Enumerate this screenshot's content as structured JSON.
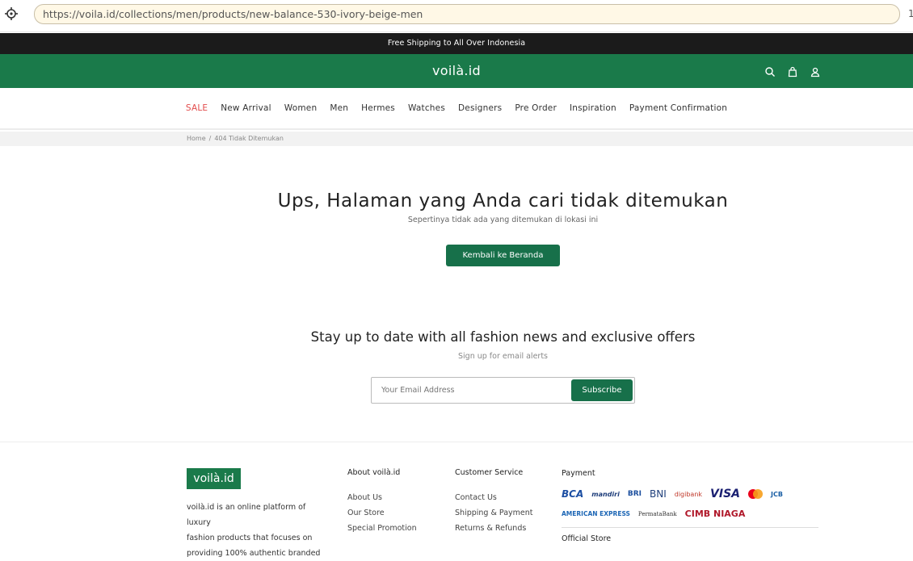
{
  "browser": {
    "url": "https://voila.id/collections/men/products/new-balance-530-ivory-beige-men",
    "trail": "1"
  },
  "announcement": "Free Shipping to All Over Indonesia",
  "header": {
    "logo": "voilà.id",
    "icons": [
      "search-icon",
      "cart-icon",
      "user-icon"
    ]
  },
  "nav": {
    "items": [
      "SALE",
      "New Arrival",
      "Women",
      "Men",
      "Hermes",
      "Watches",
      "Designers",
      "Pre Order",
      "Inspiration",
      "Payment Confirmation"
    ]
  },
  "breadcrumb": {
    "home": "Home",
    "separator": "/",
    "current": "404 Tidak Ditemukan"
  },
  "error": {
    "title": "Ups, Halaman yang Anda cari tidak ditemukan",
    "subtitle": "Sepertinya tidak ada yang ditemukan di lokasi ini",
    "button": "Kembali ke Beranda"
  },
  "newsletter": {
    "title": "Stay up to date with all fashion news and exclusive offers",
    "subtitle": "Sign up for email alerts",
    "placeholder": "Your Email Address",
    "button": "Subscribe"
  },
  "footer": {
    "logo": "voilà.id",
    "about_lines": [
      "voilà.id is an online platform of luxury",
      "fashion products that focuses on",
      "providing 100% authentic branded"
    ],
    "about_col": {
      "title": "About voilà.id",
      "links": [
        "About Us",
        "Our Store",
        "Special Promotion"
      ]
    },
    "cs_col": {
      "title": "Customer Service",
      "links": [
        "Contact Us",
        "Shipping & Payment",
        "Returns & Refunds"
      ]
    },
    "payment": {
      "title": "Payment",
      "row1": [
        "BCA",
        "mandiri",
        "BRI",
        "BNI",
        "digibank",
        "VISA",
        "mastercard",
        "JCB"
      ],
      "row2": [
        "AMERICAN EXPRESS",
        "PermataBank",
        "CIMB NIAGA"
      ]
    },
    "official_store": "Official Store"
  },
  "colors": {
    "brand_green": "#1a7a4a",
    "button_green": "#17704a",
    "sale_red": "#e24b4b",
    "announcement_bg": "#1b1b1b"
  }
}
